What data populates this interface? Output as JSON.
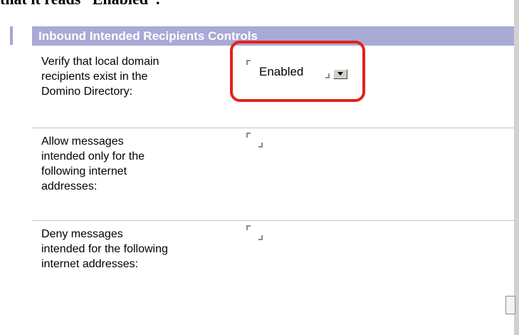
{
  "caption": {
    "text": "that it reads “Enabled”."
  },
  "section": {
    "title": "Inbound Intended Recipients Controls"
  },
  "rows": [
    {
      "label": "Verify that local domain\nrecipients exist in the\nDomino Directory:",
      "value": "Enabled",
      "has_dropdown": true
    },
    {
      "label": "Allow messages\nintended only for the\nfollowing internet\naddresses:",
      "value": ""
    },
    {
      "label": "Deny messages\nintended for the following\ninternet addresses:",
      "value": ""
    }
  ],
  "colors": {
    "header_bg": "#a9a9d6",
    "highlight": "#e2231a"
  }
}
